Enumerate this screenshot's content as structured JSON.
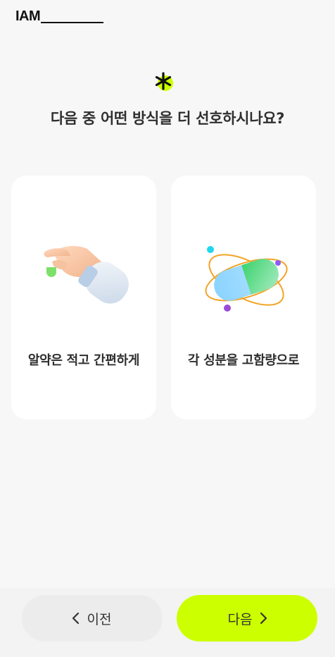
{
  "brand": {
    "logo_text": "IAM"
  },
  "question": {
    "text": "다음 중 어떤 방식을 더 선호하시나요?"
  },
  "options": [
    {
      "label": "알약은 적고 간편하게",
      "illustration": "hand-holding-pill"
    },
    {
      "label": "각 성분을 고함량으로",
      "illustration": "capsule-with-orbits"
    }
  ],
  "nav": {
    "prev_label": "이전",
    "next_label": "다음"
  },
  "colors": {
    "accent": "#ccff00",
    "card_bg": "#ffffff",
    "page_bg": "#f7f7f7",
    "prev_bg": "#ececec"
  }
}
